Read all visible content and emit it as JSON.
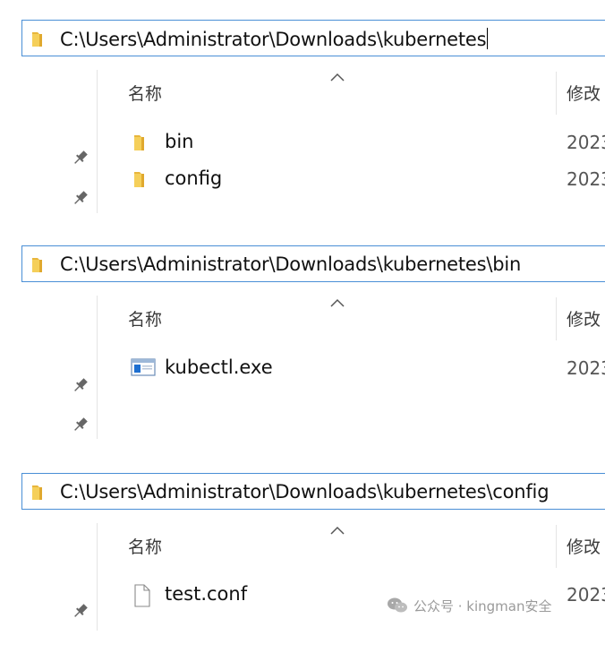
{
  "panels": [
    {
      "path": "C:\\Users\\Administrator\\Downloads\\kubernetes",
      "header": {
        "name": "名称",
        "modified": "修改"
      },
      "items": [
        {
          "name": "bin",
          "type": "folder",
          "date": "2023"
        },
        {
          "name": "config",
          "type": "folder",
          "date": "2023"
        }
      ]
    },
    {
      "path": "C:\\Users\\Administrator\\Downloads\\kubernetes\\bin",
      "header": {
        "name": "名称",
        "modified": "修改"
      },
      "items": [
        {
          "name": "kubectl.exe",
          "type": "executable",
          "date": "2023"
        }
      ]
    },
    {
      "path": "C:\\Users\\Administrator\\Downloads\\kubernetes\\config",
      "header": {
        "name": "名称",
        "modified": "修改"
      },
      "items": [
        {
          "name": "test.conf",
          "type": "file",
          "date": "2023"
        }
      ]
    }
  ],
  "watermark": {
    "text": "公众号 · kingman安全"
  },
  "colors": {
    "folder": "#f0c44c",
    "address_border": "#4a8fd6",
    "exe_blue": "#1e6fd0"
  },
  "icons": [
    "folder-icon",
    "pin-icon",
    "sort-up-icon",
    "exe-icon",
    "document-icon",
    "wechat-icon"
  ]
}
